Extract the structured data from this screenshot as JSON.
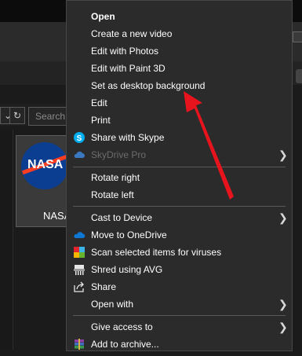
{
  "background": {
    "search_placeholder": "Search",
    "nav_refresh": "↻",
    "nav_dropdown": "⌄",
    "thumbnail_label": "NASA",
    "thumbnail_logo_text": "NASA"
  },
  "menu": {
    "items": [
      {
        "label": "Open",
        "bold": true
      },
      {
        "label": "Create a new video"
      },
      {
        "label": "Edit with Photos"
      },
      {
        "label": "Edit with Paint 3D"
      },
      {
        "label": "Set as desktop background"
      },
      {
        "label": "Edit"
      },
      {
        "label": "Print"
      },
      {
        "label": "Share with Skype",
        "icon": "skype-icon"
      },
      {
        "label": "SkyDrive Pro",
        "icon": "cloud-icon",
        "disabled": true,
        "submenu": true
      },
      {
        "label": "Rotate right"
      },
      {
        "label": "Rotate left"
      },
      {
        "label": "Cast to Device",
        "submenu": true
      },
      {
        "label": "Move to OneDrive",
        "icon": "onedrive-icon"
      },
      {
        "label": "Scan selected items for viruses",
        "icon": "avg-scan-icon"
      },
      {
        "label": "Shred using AVG",
        "icon": "shredder-icon"
      },
      {
        "label": "Share",
        "icon": "share-icon"
      },
      {
        "label": "Open with",
        "submenu": true
      },
      {
        "label": "Give access to",
        "submenu": true
      },
      {
        "label": "Add to archive...",
        "icon": "archive-icon"
      }
    ]
  },
  "colors": {
    "menu_bg": "#2b2b2b",
    "menu_text": "#ffffff",
    "disabled_text": "#6d6d6d",
    "annotation_arrow": "#e8141d",
    "skype_blue": "#00aff0",
    "onedrive_blue": "#0364b8"
  }
}
